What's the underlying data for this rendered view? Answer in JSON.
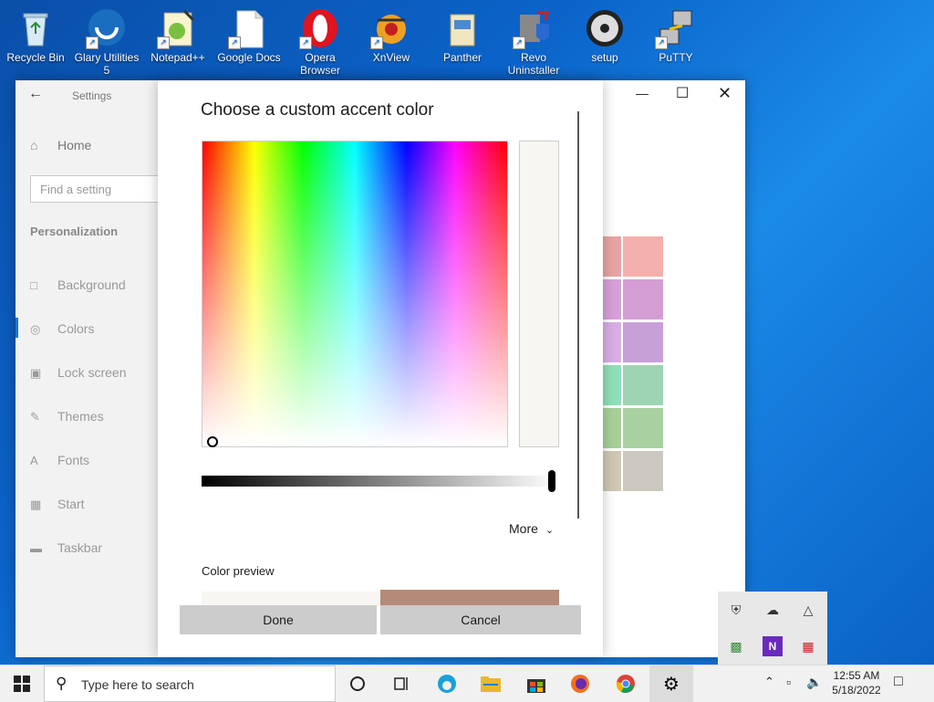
{
  "desktop": {
    "icons": [
      {
        "label": "Recycle Bin",
        "icon": "recycle-bin-icon"
      },
      {
        "label": "Glary Utilities 5",
        "icon": "glary-utilities-icon"
      },
      {
        "label": "Notepad++",
        "icon": "notepadpp-icon"
      },
      {
        "label": "Google Docs",
        "icon": "google-docs-icon"
      },
      {
        "label": "Opera Browser",
        "icon": "opera-icon"
      },
      {
        "label": "XnView",
        "icon": "xnview-icon"
      },
      {
        "label": "Panther",
        "icon": "panther-icon"
      },
      {
        "label": "Revo Uninstaller",
        "icon": "revo-uninstaller-icon"
      },
      {
        "label": "setup",
        "icon": "setup-disc-icon"
      },
      {
        "label": "PuTTY",
        "icon": "putty-icon"
      }
    ]
  },
  "settings": {
    "title": "Settings",
    "home": "Home",
    "search_placeholder": "Find a setting",
    "section": "Personalization",
    "nav": [
      {
        "label": "Background",
        "icon": "picture-icon"
      },
      {
        "label": "Colors",
        "icon": "palette-icon"
      },
      {
        "label": "Lock screen",
        "icon": "lock-screen-icon"
      },
      {
        "label": "Themes",
        "icon": "themes-icon"
      },
      {
        "label": "Fonts",
        "icon": "fonts-icon"
      },
      {
        "label": "Start",
        "icon": "start-icon"
      },
      {
        "label": "Taskbar",
        "icon": "taskbar-icon"
      }
    ],
    "swatches": [
      [
        "#e8a4a4",
        "#f4b0ac"
      ],
      [
        "#d8a0d8",
        "#d49ed4"
      ],
      [
        "#d8aee4",
        "#c8a0d8"
      ],
      [
        "#8ee0b8",
        "#9ed4b4"
      ],
      [
        "#a8d098",
        "#a8d0a0"
      ],
      [
        "#d0c8b4",
        "#ccc8c0"
      ]
    ]
  },
  "dialog": {
    "title": "Choose a custom accent color",
    "more": "More",
    "preview_label": "Color preview",
    "done": "Done",
    "cancel": "Cancel",
    "current_color": "#f8f6f3",
    "preview_dark": "#b48a78",
    "brightness": 1.0
  },
  "taskbar": {
    "search_text": "Type here to search",
    "time": "12:55 AM",
    "date": "5/18/2022"
  }
}
